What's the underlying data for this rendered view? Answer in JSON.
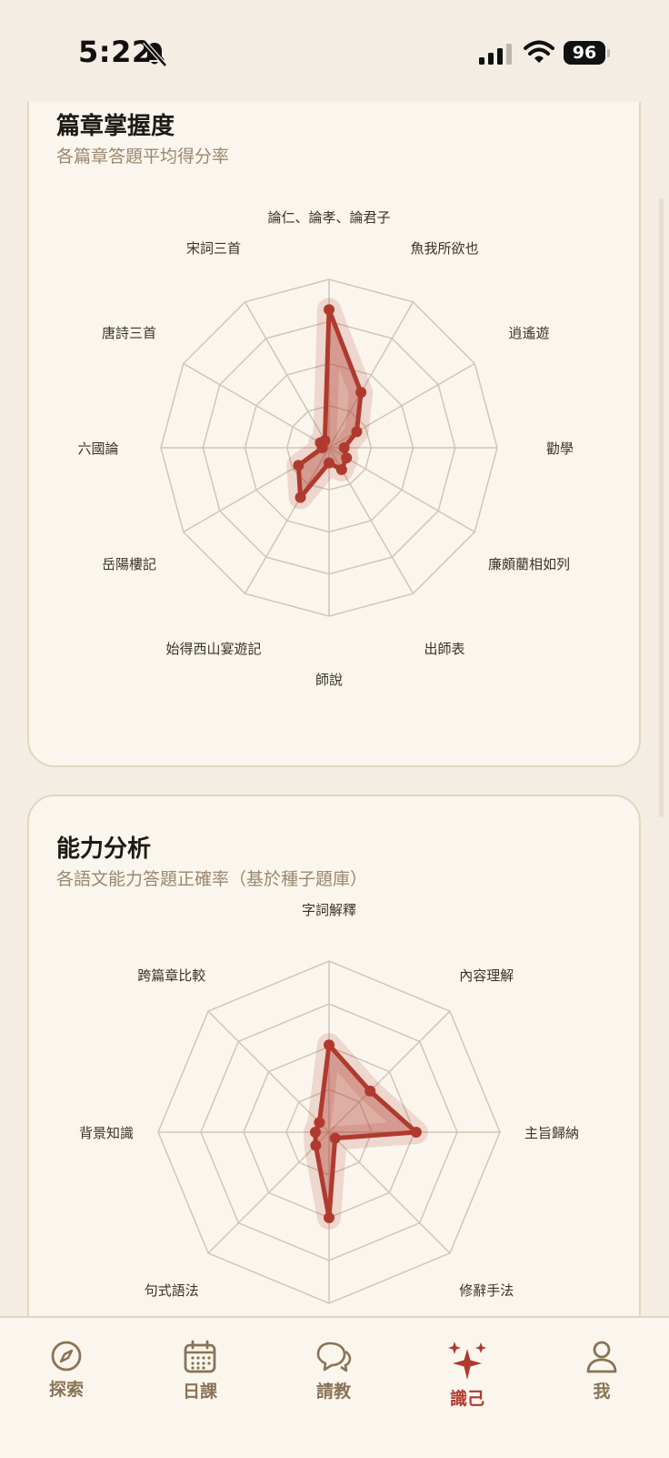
{
  "status": {
    "time": "5:22",
    "battery": "96"
  },
  "cards": {
    "chapters": {
      "title": "篇章掌握度",
      "subtitle": "各篇章答題平均得分率",
      "radar": {
        "labels": [
          "論仁、論孝、論君子",
          "魚我所欲也",
          "逍遙遊",
          "勸學",
          "廉頗藺相如列",
          "出師表",
          "師說",
          "始得西山宴遊記",
          "岳陽樓記",
          "六國論",
          "唐詩三首",
          "宋詞三首"
        ],
        "values": [
          0.82,
          0.38,
          0.19,
          0.09,
          0.12,
          0.15,
          0.09,
          0.34,
          0.21,
          0.04,
          0.06,
          0.05
        ]
      }
    },
    "abilities": {
      "title": "能力分析",
      "subtitle": "各語文能力答題正確率（基於種子題庫）",
      "radar": {
        "labels": [
          "字詞解釋",
          "內容理解",
          "主旨歸納",
          "修辭手法",
          "",
          "句式語法",
          "背景知識",
          "跨篇章比較"
        ],
        "values": [
          0.51,
          0.34,
          0.51,
          0.05,
          0.5,
          0.11,
          0.08,
          0.08
        ]
      }
    }
  },
  "chart_data": [
    {
      "type": "radar",
      "title": "篇章掌握度",
      "subtitle": "各篇章答題平均得分率",
      "categories": [
        "論仁、論孝、論君子",
        "魚我所欲也",
        "逍遙遊",
        "勸學",
        "廉頗藺相如列",
        "出師表",
        "師說",
        "始得西山宴遊記",
        "岳陽樓記",
        "六國論",
        "唐詩三首",
        "宋詞三首"
      ],
      "values": [
        0.82,
        0.38,
        0.19,
        0.09,
        0.12,
        0.15,
        0.09,
        0.34,
        0.21,
        0.04,
        0.06,
        0.05
      ],
      "ylim": [
        0,
        1
      ],
      "rings": 4
    },
    {
      "type": "radar",
      "title": "能力分析",
      "subtitle": "各語文能力答題正確率（基於種子題庫）",
      "categories": [
        "字詞解釋",
        "內容理解",
        "主旨歸納",
        "修辭手法",
        "",
        "句式語法",
        "背景知識",
        "跨篇章比較"
      ],
      "values": [
        0.51,
        0.34,
        0.51,
        0.05,
        0.5,
        0.11,
        0.08,
        0.08
      ],
      "ylim": [
        0,
        1
      ],
      "rings": 4
    }
  ],
  "tabs": [
    {
      "label": "探索",
      "icon": "compass-icon"
    },
    {
      "label": "日課",
      "icon": "calendar-icon"
    },
    {
      "label": "請教",
      "icon": "chat-bubbles-icon"
    },
    {
      "label": "識己",
      "icon": "sparkles-icon",
      "active": true
    },
    {
      "label": "我",
      "icon": "person-icon"
    }
  ],
  "colors": {
    "accent": "#b03a2e",
    "grid": "#d2c6b4",
    "background": "#f4ede3",
    "card": "#faf6ed"
  }
}
